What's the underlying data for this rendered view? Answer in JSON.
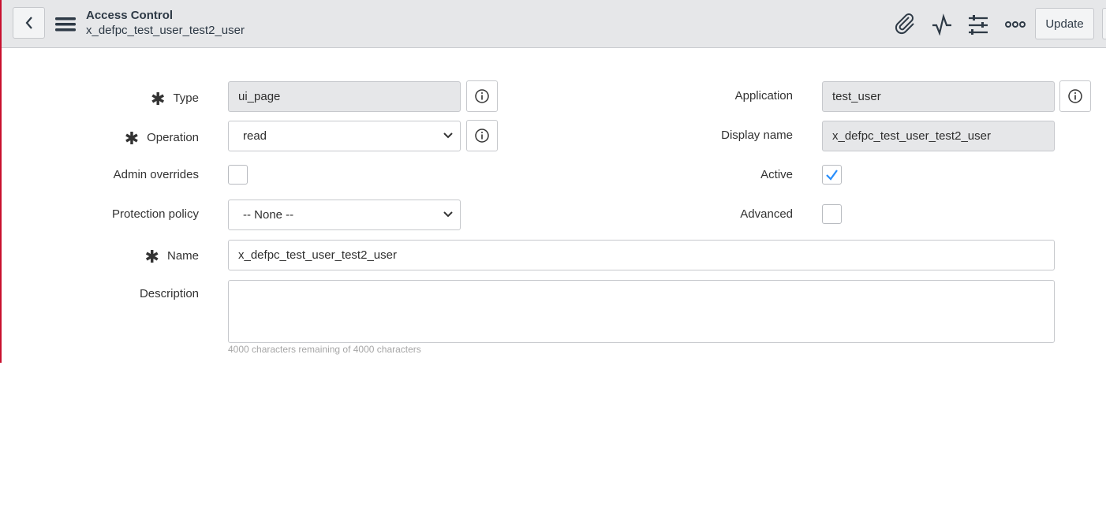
{
  "header": {
    "title": "Access Control",
    "subtitle": "x_defpc_test_user_test2_user",
    "update_label": "Update",
    "icons": [
      "back-icon",
      "menu-icon",
      "paperclip-icon",
      "activity-icon",
      "settings-sliders-icon",
      "more-icon"
    ]
  },
  "form": {
    "type": {
      "label": "Type",
      "value": "ui_page",
      "required": true
    },
    "operation": {
      "label": "Operation",
      "value": "read",
      "required": true
    },
    "admin_overrides": {
      "label": "Admin overrides",
      "checked": false
    },
    "protection_policy": {
      "label": "Protection policy",
      "value": "-- None --"
    },
    "name": {
      "label": "Name",
      "value": "x_defpc_test_user_test2_user",
      "required": true
    },
    "description": {
      "label": "Description",
      "value": "",
      "counter": "4000 characters remaining of 4000 characters"
    },
    "application": {
      "label": "Application",
      "value": "test_user"
    },
    "display_name": {
      "label": "Display name",
      "value": "x_defpc_test_user_test2_user"
    },
    "active": {
      "label": "Active",
      "checked": true
    },
    "advanced": {
      "label": "Advanced",
      "checked": false
    }
  },
  "colors": {
    "accent": "#278efc",
    "header_bg": "#e6e7e9",
    "left_border": "#c8102e"
  }
}
